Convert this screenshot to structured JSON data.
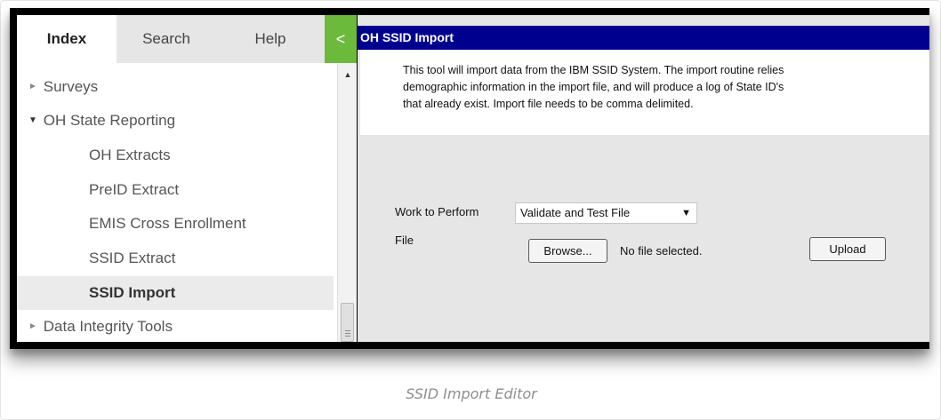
{
  "nav": {
    "tabs": [
      {
        "label": "Index",
        "active": true
      },
      {
        "label": "Search",
        "active": false
      },
      {
        "label": "Help",
        "active": false
      }
    ],
    "collapse_icon": "<",
    "tree": [
      {
        "label": "Surveys",
        "level": 0,
        "caret": "collapsed"
      },
      {
        "label": "OH State Reporting",
        "level": 0,
        "caret": "expanded"
      },
      {
        "label": "OH Extracts",
        "level": 1
      },
      {
        "label": "PreID Extract",
        "level": 1
      },
      {
        "label": "EMIS Cross Enrollment",
        "level": 1
      },
      {
        "label": "SSID Extract",
        "level": 1
      },
      {
        "label": "SSID Import",
        "level": 1,
        "selected": true
      },
      {
        "label": "Data Integrity Tools",
        "level": 0,
        "caret": "collapsed"
      }
    ],
    "caret_collapsed": "►",
    "caret_expanded": "▼"
  },
  "content": {
    "title": "OH SSID Import",
    "description": "This tool will import data from the IBM SSID System. The import routine relies\ndemographic information in the import file, and will produce a log of State ID's\nthat already exist. Import file needs to be comma delimited.",
    "work_label": "Work to Perform",
    "work_value": "Validate and Test File",
    "file_label": "File",
    "browse_label": "Browse...",
    "file_status": "No file selected.",
    "upload_label": "Upload"
  },
  "caption": "SSID Import Editor",
  "colors": {
    "title_bar": "#00008f",
    "accent_green": "#6cba3c",
    "panel_gray": "#e6e6e6"
  }
}
